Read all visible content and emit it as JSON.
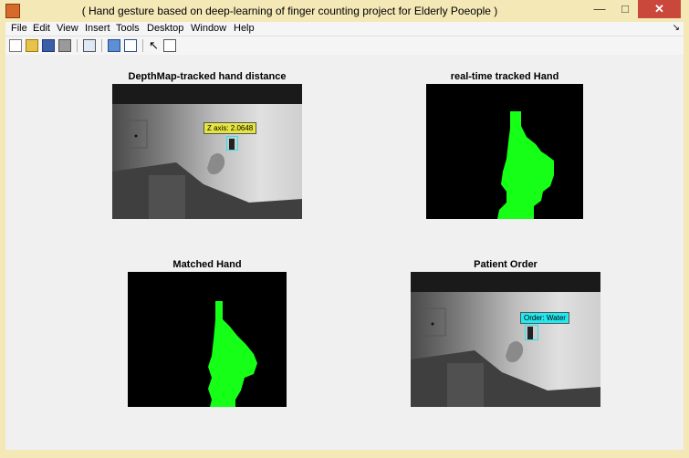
{
  "window": {
    "title": "( Hand gesture based on deep-learning of finger counting project for Elderly Poeople )"
  },
  "menu": [
    "File",
    "Edit",
    "View",
    "Insert",
    "Tools",
    "Desktop",
    "Window",
    "Help"
  ],
  "toolbar_icons": [
    "new-figure-icon",
    "open-file-icon",
    "save-icon",
    "print-icon",
    "print-preview-icon",
    "link-plot-icon",
    "insert-colorbar-icon",
    "insert-legend-icon",
    "select-arrow-icon",
    "property-inspector-icon"
  ],
  "panels": {
    "depth_map": {
      "title": "DepthMap-tracked hand distance",
      "tooltip": "Z axis: 2.0648"
    },
    "tracked_hand": {
      "title": "real-time tracked Hand"
    },
    "matched_hand": {
      "title": "Matched Hand"
    },
    "patient_order": {
      "title": "Patient Order",
      "tooltip": "Order: Water"
    }
  },
  "colors": {
    "hand_green": "#16ff16",
    "tooltip_yellow": "#e6e640",
    "tooltip_cyan": "#22e8f0",
    "close_red": "#c9473b"
  }
}
